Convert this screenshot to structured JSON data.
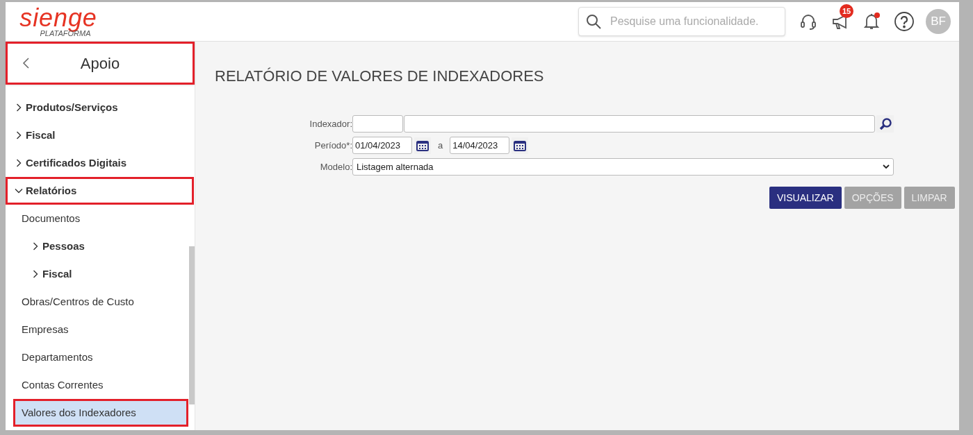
{
  "header": {
    "logo": {
      "wordmark": "sienge",
      "subtitle": "PLATAFORMA"
    },
    "search": {
      "placeholder": "Pesquise uma funcionalidade."
    },
    "notifications_badge": "15",
    "bell_unread": true,
    "avatar": "BF"
  },
  "sidebar": {
    "title": "Apoio",
    "title_highlighted": true,
    "items": [
      {
        "label": "Produtos/Serviços",
        "expanded": false,
        "selected": false,
        "highlighted": false
      },
      {
        "label": "Fiscal",
        "expanded": false,
        "selected": false,
        "highlighted": false
      },
      {
        "label": "Certificados Digitais",
        "expanded": false,
        "selected": false,
        "highlighted": false
      },
      {
        "label": "Relatórios",
        "expanded": true,
        "selected": false,
        "highlighted": true,
        "children": [
          {
            "label": "Documentos",
            "kind": "leaf",
            "selected": false,
            "highlighted": false
          },
          {
            "label": "Pessoas",
            "kind": "group",
            "expanded": false,
            "selected": false,
            "highlighted": false
          },
          {
            "label": "Fiscal",
            "kind": "group",
            "expanded": false,
            "selected": false,
            "highlighted": false
          },
          {
            "label": "Obras/Centros de Custo",
            "kind": "leaf",
            "selected": false,
            "highlighted": false
          },
          {
            "label": "Empresas",
            "kind": "leaf",
            "selected": false,
            "highlighted": false
          },
          {
            "label": "Departamentos",
            "kind": "leaf",
            "selected": false,
            "highlighted": false
          },
          {
            "label": "Contas Correntes",
            "kind": "leaf",
            "selected": false,
            "highlighted": false
          },
          {
            "label": "Valores dos Indexadores",
            "kind": "leaf",
            "selected": true,
            "highlighted": true
          }
        ]
      }
    ]
  },
  "page": {
    "title": "RELATÓRIO DE VALORES DE INDEXADORES",
    "form": {
      "indexador": {
        "label": "Indexador:"
      },
      "periodo": {
        "label": "Período*:",
        "start": "01/04/2023",
        "separator": "a",
        "end": "14/04/2023"
      },
      "modelo": {
        "label": "Modelo:",
        "value": "Listagem alternada"
      }
    },
    "buttons": [
      {
        "label": "VISUALIZAR",
        "disabled": false
      },
      {
        "label": "OPÇÕES",
        "disabled": true
      },
      {
        "label": "LIMPAR",
        "disabled": true
      }
    ]
  }
}
